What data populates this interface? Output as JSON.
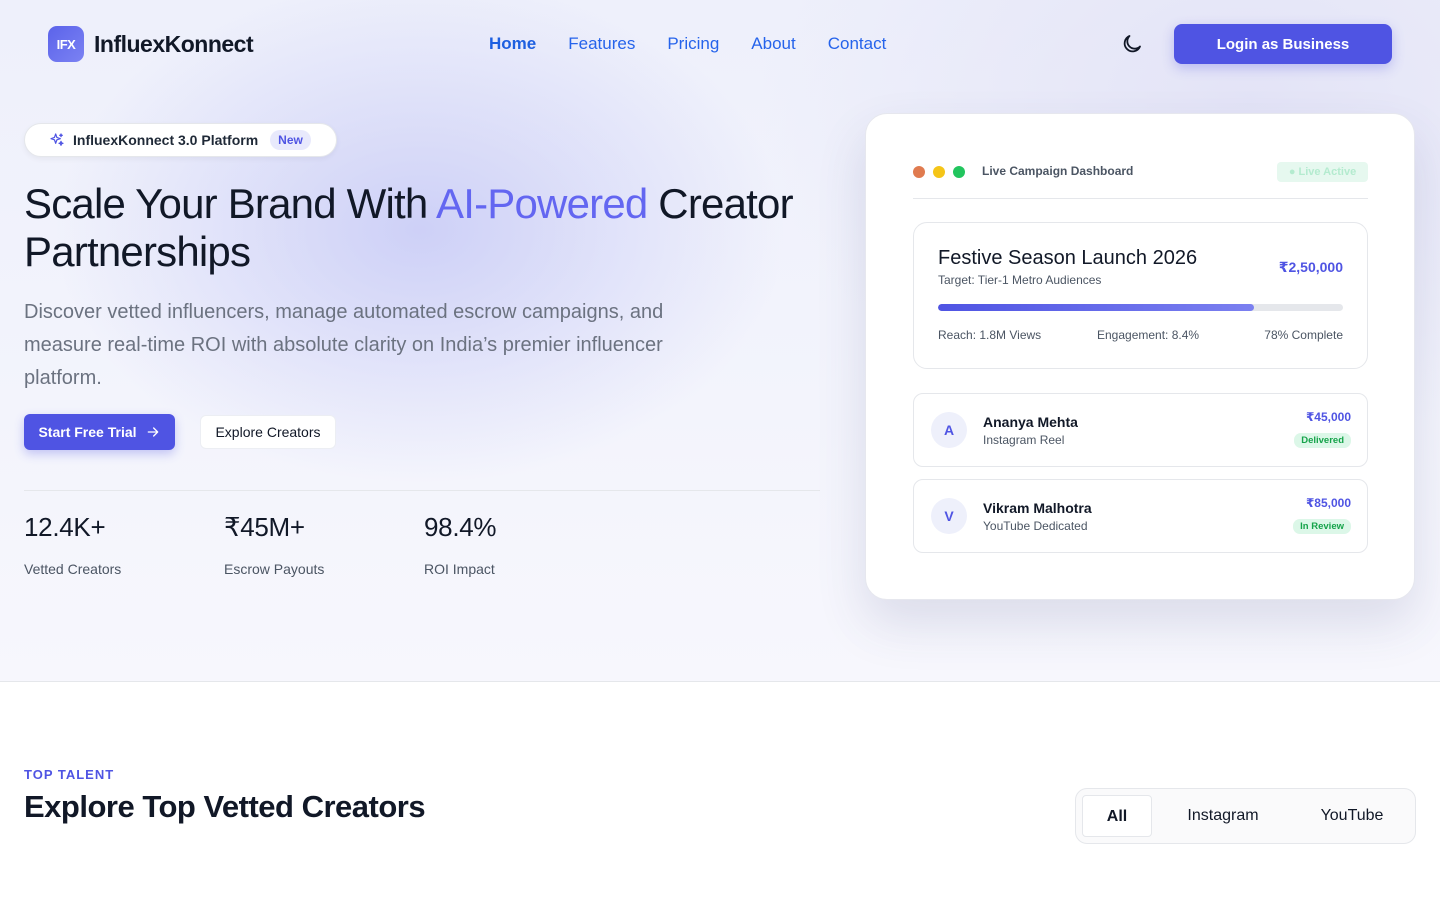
{
  "brand": {
    "logo_text": "IFX",
    "name": "InfluexKonnect"
  },
  "nav": {
    "items": [
      {
        "label": "Home",
        "active": true
      },
      {
        "label": "Features"
      },
      {
        "label": "Pricing"
      },
      {
        "label": "About"
      },
      {
        "label": "Contact"
      }
    ],
    "theme_icon": "moon-icon",
    "login_label": "Login as Business"
  },
  "hero": {
    "badge_text": "InfluexKonnect 3.0 Platform",
    "badge_new": "New",
    "badge_icon": "sparkle-icon",
    "headline_before": "Scale Your Brand With ",
    "headline_accent": "AI-Powered",
    "headline_after": " Creator Partnerships",
    "subtext": "Discover vetted influencers, manage automated escrow campaigns, and measure real-time ROI with absolute clarity on India’s premier influencer platform.",
    "primary_cta": "Start Free Trial",
    "secondary_cta": "Explore Creators",
    "stats": [
      {
        "value": "12.4K+",
        "label": "Vetted Creators"
      },
      {
        "value": "₹45M+",
        "label": "Escrow Payouts"
      },
      {
        "value": "98.4%",
        "label": "ROI Impact"
      }
    ]
  },
  "dashboard": {
    "title": "Live Campaign Dashboard",
    "status": "● Live Active",
    "campaign": {
      "title": "Festive Season Launch 2026",
      "target": "Target: Tier-1 Metro Audiences",
      "budget": "₹2,50,000",
      "progress": 0.78,
      "reach": "Reach: 1.8M Views",
      "engagement": "Engagement: 8.4%",
      "complete": "78% Complete"
    },
    "creators": [
      {
        "initial": "A",
        "name": "Ananya Mehta",
        "type": "Instagram Reel",
        "amount": "₹45,000",
        "status": "Delivered"
      },
      {
        "initial": "V",
        "name": "Vikram Malhotra",
        "type": "YouTube Dedicated",
        "amount": "₹85,000",
        "status": "In Review"
      }
    ]
  },
  "section": {
    "eyebrow": "TOP TALENT",
    "title": "Explore Top Vetted Creators",
    "filters": [
      "All",
      "Instagram",
      "YouTube"
    ]
  },
  "colors": {
    "accent": "#4f54e3",
    "success": "#16a34a",
    "dot_red": "#e07b4f",
    "dot_yellow": "#f5c518",
    "dot_green": "#22c55e"
  }
}
